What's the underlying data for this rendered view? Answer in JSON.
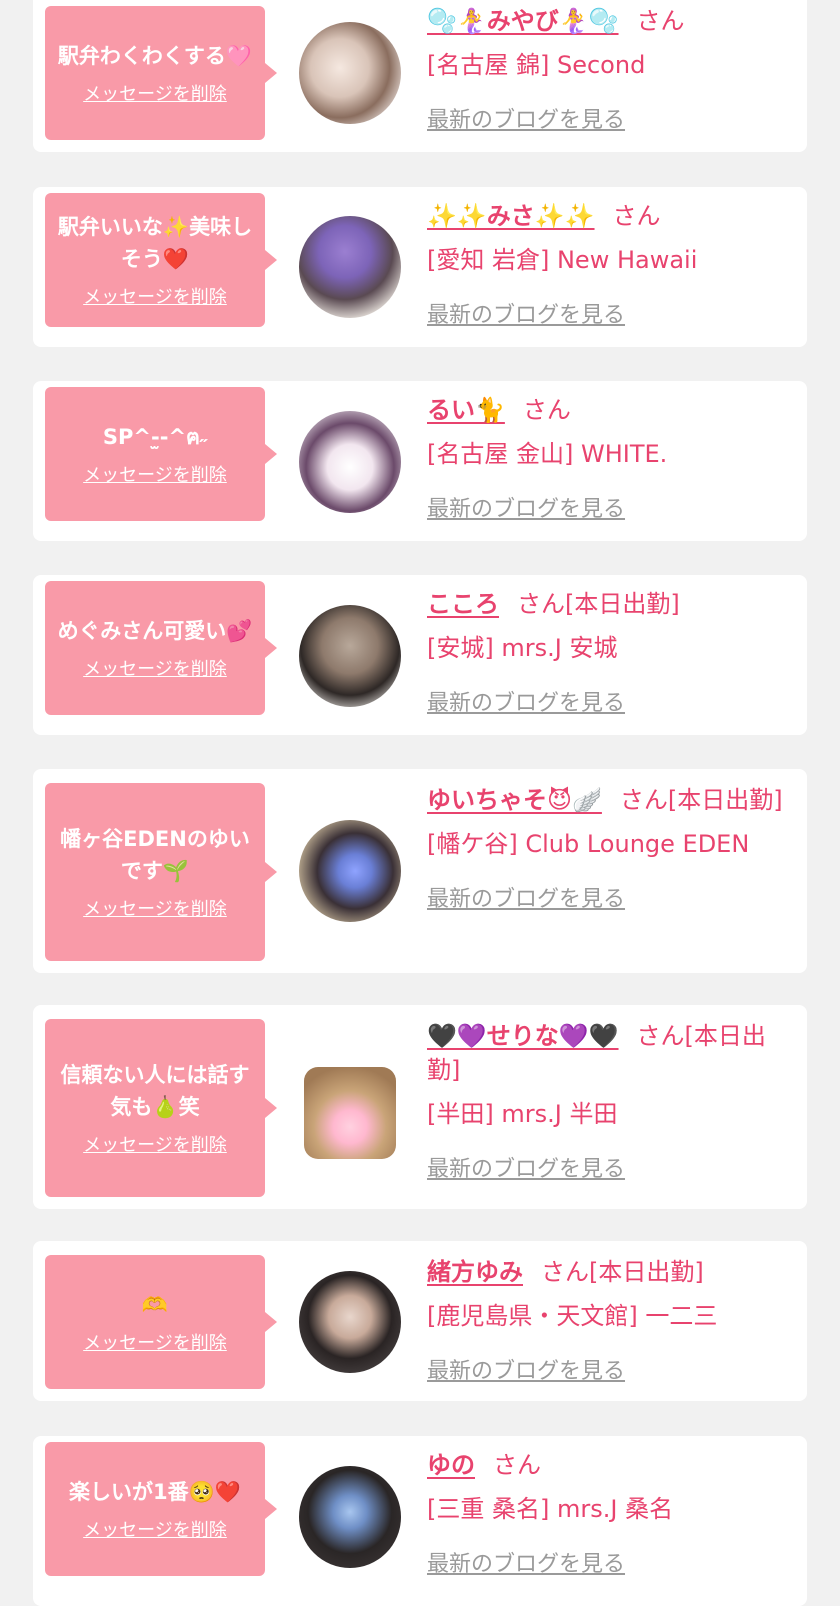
{
  "delete_label": "メッセージを削除",
  "blog_label": "最新のブログを見る",
  "san_suffix": "さん",
  "colors": {
    "accent": "#e8436e",
    "bubble": "#f99aa8",
    "link_gray": "#9a9a9a",
    "background": "#f1f1f1"
  },
  "items": [
    {
      "message": "駅弁わくわくする🩷",
      "name": "🫧🧜‍♀️みやび🧜‍♀️🫧",
      "suffix": "さん",
      "shop": "[名古屋 錦] Second"
    },
    {
      "message": "駅弁いいな✨美味しそう❤️",
      "name": "✨✨みさ✨✨",
      "suffix": "さん",
      "shop": "[愛知 岩倉] New Hawaii"
    },
    {
      "message": "SP^-̫-^ฅ˶",
      "name": "るい🐈",
      "suffix": "さん",
      "shop": "[名古屋 金山] WHITE."
    },
    {
      "message": "めぐみさん可愛い💕",
      "name": "こころ",
      "suffix": "さん[本日出勤]",
      "shop": "[安城] mrs.J 安城"
    },
    {
      "message": "幡ヶ谷EDENのゆいです🌱",
      "name": "ゆいちゃそ😈🪽",
      "suffix": "さん[本日出勤]",
      "shop": "[幡ケ谷] Club Lounge EDEN"
    },
    {
      "message": "信頼ない人には話す気も🍐笑",
      "name": "🖤💜せりな💜🖤",
      "suffix": "さん[本日出勤]",
      "shop": "[半田] mrs.J 半田"
    },
    {
      "message": "🫶",
      "name": "緒方ゆみ",
      "suffix": "さん[本日出勤]",
      "shop": "[鹿児島県・天文館] 一二三"
    },
    {
      "message": "楽しいが1番🥺❤️",
      "name": "ゆの",
      "suffix": "さん",
      "shop": "[三重 桑名] mrs.J 桑名"
    }
  ]
}
